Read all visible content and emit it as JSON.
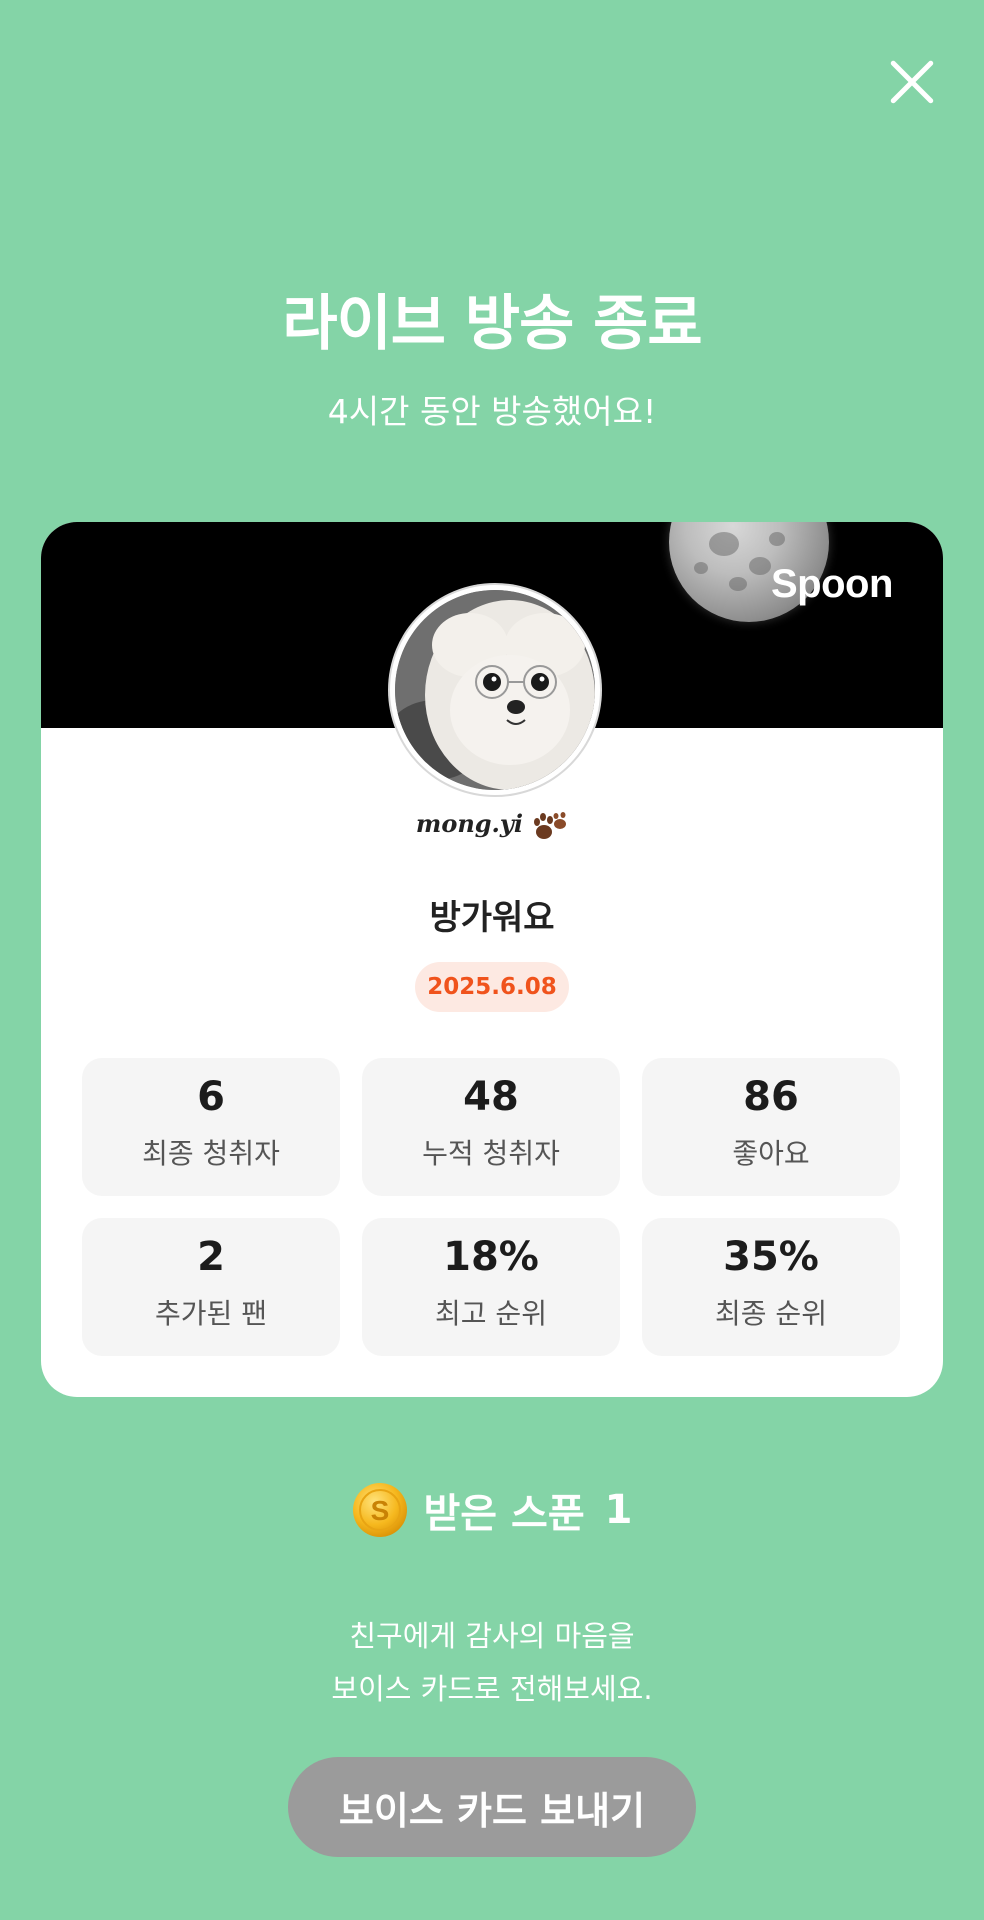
{
  "header": {
    "close_icon": "close-icon",
    "title": "라이브 방송 종료",
    "subtitle": "4시간 동안 방송했어요!"
  },
  "card": {
    "brand": "Spoon",
    "nickname": "mong.yi",
    "room_title": "방가워요",
    "date": "2025.6.08",
    "stats": [
      {
        "value": "6",
        "label": "최종 청취자"
      },
      {
        "value": "48",
        "label": "누적 청취자"
      },
      {
        "value": "86",
        "label": "좋아요"
      },
      {
        "value": "2",
        "label": "추가된 팬"
      },
      {
        "value": "18%",
        "label": "최고 순위"
      },
      {
        "value": "35%",
        "label": "최종 순위"
      }
    ]
  },
  "spoons": {
    "label": "받은 스푼",
    "count": "1"
  },
  "thanks": {
    "line1": "친구에게 감사의 마음을",
    "line2": "보이스 카드로 전해보세요."
  },
  "send_button": "보이스 카드 보내기",
  "colors": {
    "background": "#84d4a7",
    "date_accent": "#f0531c",
    "button": "#9b9b9b"
  }
}
